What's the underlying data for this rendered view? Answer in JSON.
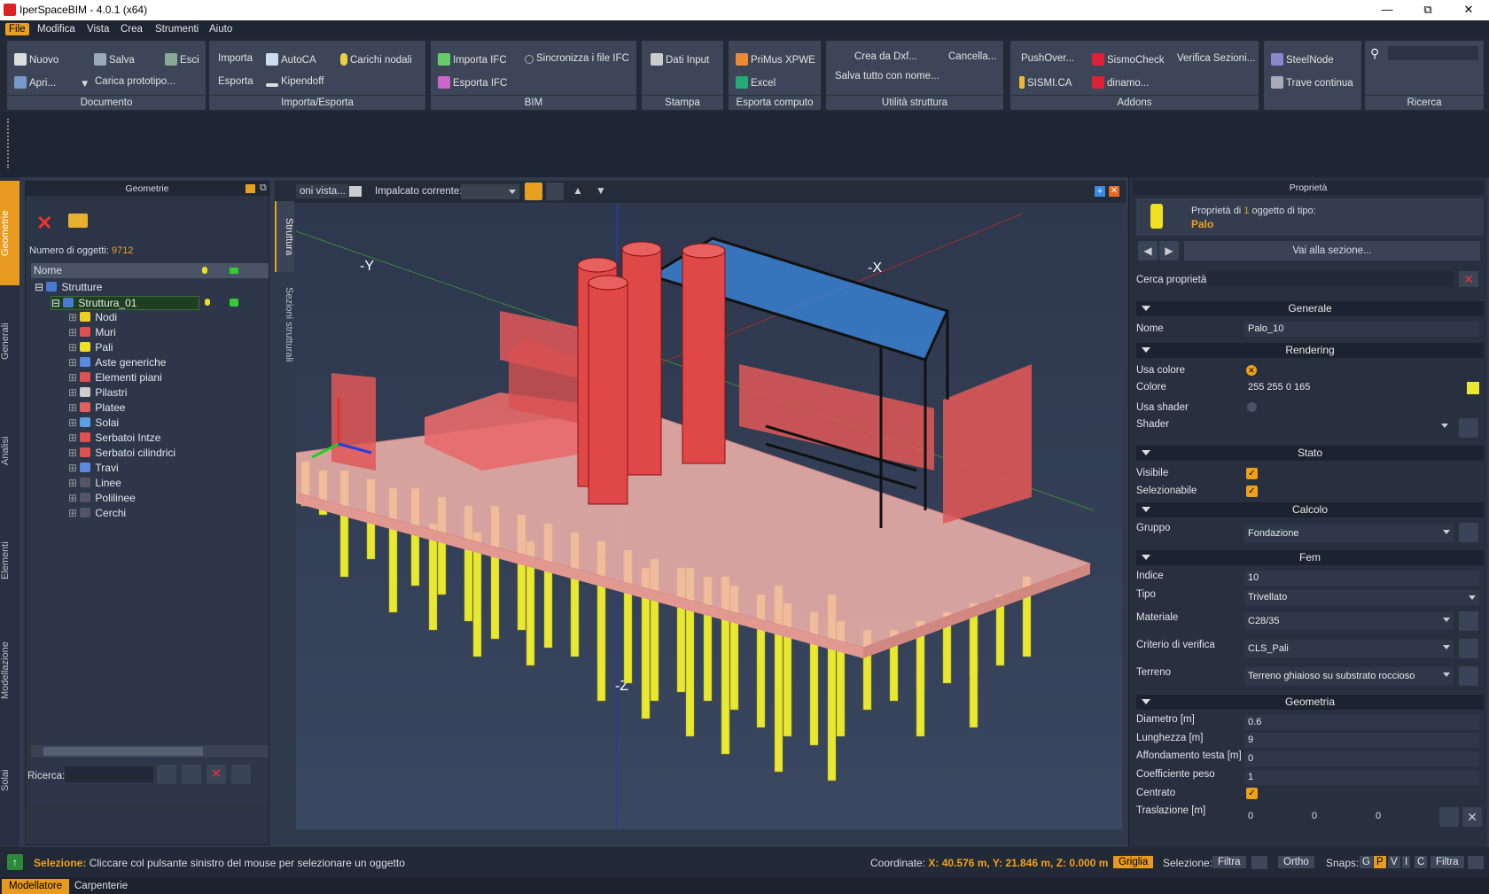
{
  "app": {
    "title": "IperSpaceBIM - 4.0.1 (x64)"
  },
  "menu": [
    "File",
    "Modifica",
    "Vista",
    "Crea",
    "Strumenti",
    "Aiuto"
  ],
  "ribbon": {
    "documento": {
      "label": "Documento",
      "nuovo": "Nuovo",
      "salva": "Salva",
      "esci": "Esci",
      "apri": "Apri...",
      "carica": "Carica prototipo..."
    },
    "importa": {
      "label": "Importa/Esporta",
      "importa": "Importa",
      "autoca": "AutoCA",
      "carichi": "Carichi nodali",
      "esporta": "Esporta",
      "kipendoff": "Kipendoff"
    },
    "bim": {
      "label": "BIM",
      "importa_ifc": "Importa IFC",
      "sincronizza": "Sincronizza i file IFC",
      "esporta_ifc": "Esporta IFC"
    },
    "stampa": {
      "label": "Stampa",
      "dati": "Dati Input"
    },
    "computo": {
      "label": "Esporta computo",
      "primus": "PriMus XPWE",
      "excel": "Excel"
    },
    "utilita": {
      "label": "Utilità struttura",
      "crea": "Crea da Dxf...",
      "cancella": "Cancella...",
      "salva_tutto": "Salva tutto con nome..."
    },
    "addons": {
      "label": "Addons",
      "pushover": "PushOver...",
      "sismocheck": "SismoCheck",
      "verifica": "Verifica Sezioni...",
      "sismica": "SISMI.CA",
      "dinamo": "dinamo..."
    },
    "steel": {
      "steelnode": "SteelNode",
      "trave": "Trave continua"
    },
    "ricerca": {
      "label": "Ricerca"
    }
  },
  "left_tabs": [
    "Geometrie",
    "Generali",
    "Analisi",
    "Elementi",
    "Modellazione",
    "Solai"
  ],
  "geometry_panel": {
    "title": "Geometrie",
    "count_label": "Numero di oggetti:",
    "count": "9712",
    "col_name": "Nome",
    "root": "Strutture",
    "selected": "Struttura_01",
    "items": [
      "Nodi",
      "Muri",
      "Pali",
      "Aste generiche",
      "Elementi piani",
      "Pilastri",
      "Platee",
      "Solai",
      "Serbatoi Intze",
      "Serbatoi cilindrici",
      "Travi",
      "Linee",
      "Polilinee",
      "Cerchi"
    ],
    "search_label": "Ricerca:"
  },
  "view_toolbar": {
    "tab": "oni vista...",
    "impalcato": "Impalcato corrente:"
  },
  "side_tabs": [
    "Struttura",
    "Sezioni strutturali"
  ],
  "axes": {
    "ny": "-Y",
    "nx": "-X",
    "nz": "-Z"
  },
  "properties": {
    "title": "Proprietà",
    "header_prefix": "Proprietà di",
    "header_count": "1",
    "header_suffix": "oggetto di tipo:",
    "type": "Palo",
    "goto": "Vai alla sezione...",
    "search_label": "Cerca proprietà:",
    "sec_generale": "Generale",
    "nome_l": "Nome",
    "nome_v": "Palo_10",
    "sec_rendering": "Rendering",
    "usa_colore_l": "Usa colore",
    "colore_l": "Colore",
    "colore_v": "255 255 0 165",
    "usa_shader_l": "Usa shader",
    "shader_l": "Shader",
    "sec_stato": "Stato",
    "visibile_l": "Visibile",
    "selezionabile_l": "Selezionabile",
    "sec_calcolo": "Calcolo",
    "gruppo_l": "Gruppo",
    "gruppo_v": "Fondazione",
    "sec_fem": "Fem",
    "indice_l": "Indice",
    "indice_v": "10",
    "tipo_l": "Tipo",
    "tipo_v": "Trivellato",
    "materiale_l": "Materiale",
    "materiale_v": "C28/35",
    "criterio_l": "Criterio di verifica",
    "criterio_v": "CLS_Pali",
    "terreno_l": "Terreno",
    "terreno_v": "Terreno ghiaioso su substrato roccioso",
    "sec_geometria": "Geometria",
    "diametro_l": "Diametro [m]",
    "diametro_v": "0.6",
    "lunghezza_l": "Lunghezza [m]",
    "lunghezza_v": "9",
    "affond_l": "Affondamento testa [m]",
    "affond_v": "0",
    "coeff_l": "Coefficiente peso",
    "coeff_v": "1",
    "centrato_l": "Centrato",
    "trasl_l": "Traslazione [m]",
    "trasl_x": "0",
    "trasl_y": "0",
    "trasl_z": "0"
  },
  "status": {
    "sel_label": "Selezione:",
    "sel_text": "Cliccare col pulsante sinistro del mouse per selezionare un oggetto",
    "coord_label": "Coordinate:",
    "coord_value": "X: 40.576 m, Y: 21.846 m, Z: 0.000 m",
    "griglia": "Griglia",
    "selezione2": "Selezione:",
    "filtra": "Filtra",
    "ortho": "Ortho",
    "snaps": "Snaps:",
    "snap_keys": [
      "G",
      "P",
      "V",
      "I",
      "C"
    ],
    "filtra2": "Filtra"
  },
  "bottom_tabs": [
    "Modellatore",
    "Carpenterie"
  ],
  "colors": {
    "accent": "#e89a20",
    "pile": "#e8e830",
    "slab": "#f0b0a8",
    "wall": "#e05858"
  }
}
